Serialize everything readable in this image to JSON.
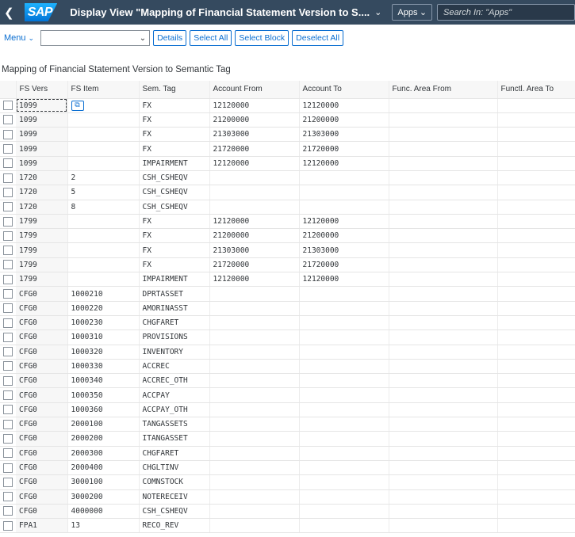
{
  "shell": {
    "back_icon": "back-arrow-icon",
    "logo": "SAP",
    "title": "Display View \"Mapping of Financial Statement Version to S....",
    "apps_label": "Apps",
    "search_placeholder": "Search In: \"Apps\""
  },
  "toolbar": {
    "menu_label": "Menu",
    "combo_value": "",
    "details_label": "Details",
    "select_all_label": "Select All",
    "select_block_label": "Select Block",
    "deselect_all_label": "Deselect All"
  },
  "table": {
    "title": "Mapping of Financial Statement Version to Semantic Tag",
    "columns": [
      "FS Vers",
      "FS Item",
      "Sem. Tag",
      "Account From",
      "Account To",
      "Func. Area From",
      "Functl. Area To"
    ],
    "rows": [
      [
        "1099",
        "",
        "FX",
        "12120000",
        "12120000",
        "",
        ""
      ],
      [
        "1099",
        "",
        "FX",
        "21200000",
        "21200000",
        "",
        ""
      ],
      [
        "1099",
        "",
        "FX",
        "21303000",
        "21303000",
        "",
        ""
      ],
      [
        "1099",
        "",
        "FX",
        "21720000",
        "21720000",
        "",
        ""
      ],
      [
        "1099",
        "",
        "IMPAIRMENT",
        "12120000",
        "12120000",
        "",
        ""
      ],
      [
        "1720",
        "2",
        "CSH_CSHEQV",
        "",
        "",
        "",
        ""
      ],
      [
        "1720",
        "5",
        "CSH_CSHEQV",
        "",
        "",
        "",
        ""
      ],
      [
        "1720",
        "8",
        "CSH_CSHEQV",
        "",
        "",
        "",
        ""
      ],
      [
        "1799",
        "",
        "FX",
        "12120000",
        "12120000",
        "",
        ""
      ],
      [
        "1799",
        "",
        "FX",
        "21200000",
        "21200000",
        "",
        ""
      ],
      [
        "1799",
        "",
        "FX",
        "21303000",
        "21303000",
        "",
        ""
      ],
      [
        "1799",
        "",
        "FX",
        "21720000",
        "21720000",
        "",
        ""
      ],
      [
        "1799",
        "",
        "IMPAIRMENT",
        "12120000",
        "12120000",
        "",
        ""
      ],
      [
        "CFG0",
        "1000210",
        "DPRTASSET",
        "",
        "",
        "",
        ""
      ],
      [
        "CFG0",
        "1000220",
        "AMORINASST",
        "",
        "",
        "",
        ""
      ],
      [
        "CFG0",
        "1000230",
        "CHGFARET",
        "",
        "",
        "",
        ""
      ],
      [
        "CFG0",
        "1000310",
        "PROVISIONS",
        "",
        "",
        "",
        ""
      ],
      [
        "CFG0",
        "1000320",
        "INVENTORY",
        "",
        "",
        "",
        ""
      ],
      [
        "CFG0",
        "1000330",
        "ACCREC",
        "",
        "",
        "",
        ""
      ],
      [
        "CFG0",
        "1000340",
        "ACCREC_OTH",
        "",
        "",
        "",
        ""
      ],
      [
        "CFG0",
        "1000350",
        "ACCPAY",
        "",
        "",
        "",
        ""
      ],
      [
        "CFG0",
        "1000360",
        "ACCPAY_OTH",
        "",
        "",
        "",
        ""
      ],
      [
        "CFG0",
        "2000100",
        "TANGASSETS",
        "",
        "",
        "",
        ""
      ],
      [
        "CFG0",
        "2000200",
        "ITANGASSET",
        "",
        "",
        "",
        ""
      ],
      [
        "CFG0",
        "2000300",
        "CHGFARET",
        "",
        "",
        "",
        ""
      ],
      [
        "CFG0",
        "2000400",
        "CHGLTINV",
        "",
        "",
        "",
        ""
      ],
      [
        "CFG0",
        "3000100",
        "COMNSTOCK",
        "",
        "",
        "",
        ""
      ],
      [
        "CFG0",
        "3000200",
        "NOTERECEIV",
        "",
        "",
        "",
        ""
      ],
      [
        "CFG0",
        "4000000",
        "CSH_CSHEQV",
        "",
        "",
        "",
        ""
      ],
      [
        "FPA1",
        "13",
        "RECO_REV",
        "",
        "",
        "",
        ""
      ]
    ]
  }
}
